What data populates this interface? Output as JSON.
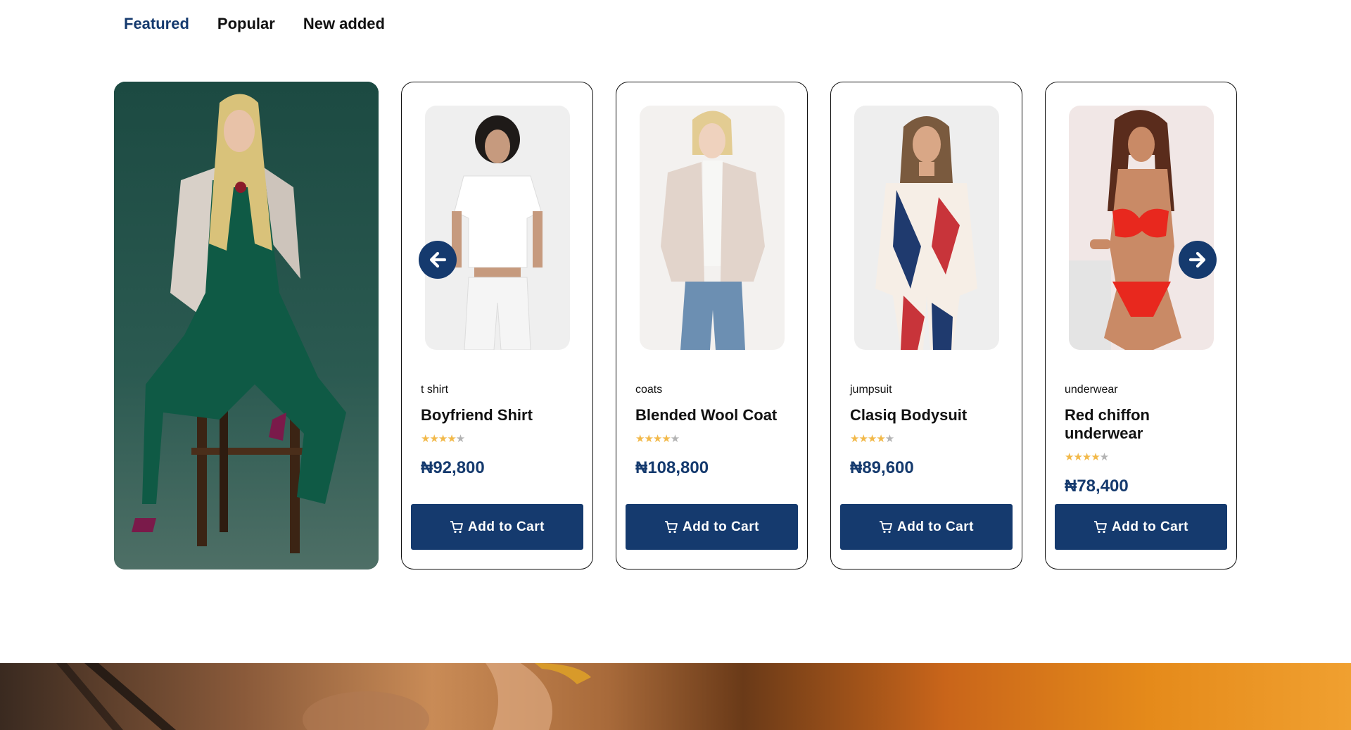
{
  "tabs": [
    {
      "label": "Featured",
      "active": true
    },
    {
      "label": "Popular",
      "active": false
    },
    {
      "label": "New added",
      "active": false
    }
  ],
  "products": [
    {
      "category": "t shirt",
      "name": "Boyfriend Shirt",
      "rating": 4,
      "max_rating": 5,
      "price": "₦92,800",
      "button_label": "Add to Cart"
    },
    {
      "category": "coats",
      "name": "Blended Wool Coat",
      "rating": 4,
      "max_rating": 5,
      "price": "₦108,800",
      "button_label": "Add to Cart"
    },
    {
      "category": "jumpsuit",
      "name": "Clasiq Bodysuit",
      "rating": 4,
      "max_rating": 5,
      "price": "₦89,600",
      "button_label": "Add to Cart"
    },
    {
      "category": "underwear",
      "name": "Red chiffon underwear",
      "rating": 4,
      "max_rating": 5,
      "price": "₦78,400",
      "button_label": "Add to Cart"
    }
  ],
  "carousel": {
    "prev_icon": "arrow-left-icon",
    "next_icon": "arrow-right-icon"
  },
  "colors": {
    "brand": "#153a6e",
    "star": "#f2b94a",
    "star_empty": "#b3b3b3"
  }
}
